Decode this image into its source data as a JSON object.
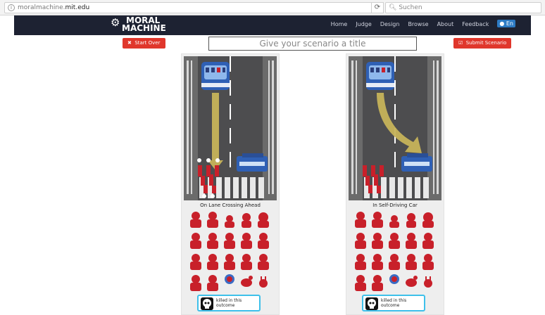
{
  "browser": {
    "url_prefix": "moralmachine.",
    "url_domain": "mit.edu",
    "search_placeholder": "Suchen"
  },
  "nav": {
    "logo_line1": "MORAL",
    "logo_line2": "MACHINE",
    "links": [
      "Home",
      "Judge",
      "Design",
      "Browse",
      "About",
      "Feedback"
    ],
    "language": "En"
  },
  "actions": {
    "start_over": "Start Over",
    "submit": "Submit Scenario"
  },
  "scenario_title_placeholder": "Give your scenario a title",
  "outcomes": [
    {
      "label": "On Lane Crossing Ahead",
      "legend": "killed in this outcome"
    },
    {
      "label": "In Self-Driving Car",
      "legend": "killed in this outcome"
    }
  ],
  "colors": {
    "nav_bg": "#1d2232",
    "accent_red": "#e0372c",
    "figure_red": "#c8202a",
    "arrow": "#c6b35a",
    "legend_border": "#3ec0ea"
  }
}
